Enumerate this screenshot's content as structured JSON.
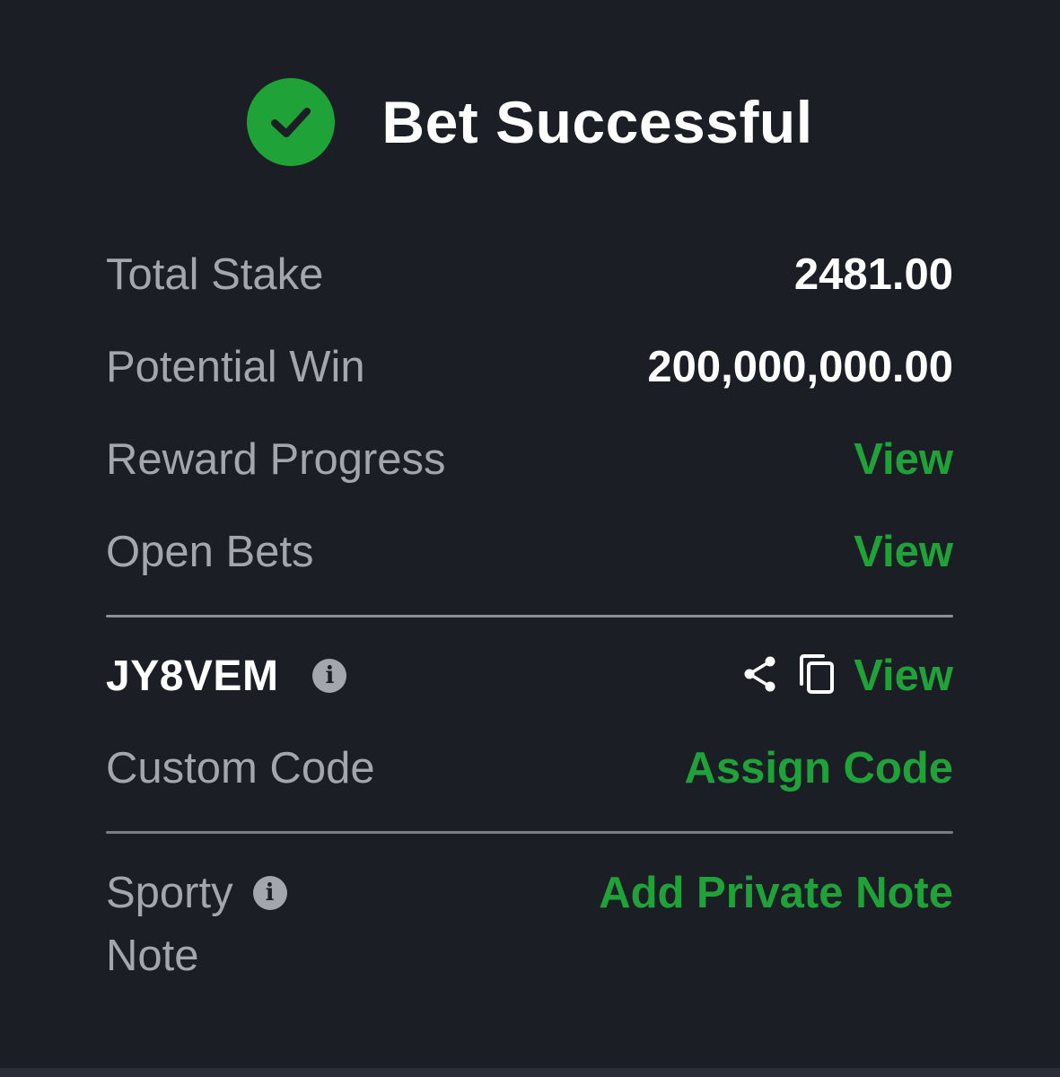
{
  "header": {
    "title": "Bet Successful",
    "icon": "check-circle-icon",
    "icon_color": "#1fa339"
  },
  "summary": {
    "total_stake_label": "Total Stake",
    "total_stake_value": "2481.00",
    "potential_win_label": "Potential Win",
    "potential_win_value": "200,000,000.00",
    "reward_progress_label": "Reward Progress",
    "reward_progress_link": "View",
    "open_bets_label": "Open Bets",
    "open_bets_link": "View"
  },
  "booking": {
    "code": "JY8VEM",
    "info_icon": "info-icon",
    "share_icon": "share-icon",
    "copy_icon": "copy-icon",
    "view_link": "View",
    "custom_code_label": "Custom Code",
    "assign_code_link": "Assign Code"
  },
  "note": {
    "label_line1": "Sporty",
    "label_line2": "Note",
    "info_icon": "info-icon",
    "add_note_link": "Add Private Note"
  },
  "colors": {
    "background": "#1c1e25",
    "accent": "#1fa339",
    "label": "#a3a6ad",
    "value": "#ffffff"
  }
}
